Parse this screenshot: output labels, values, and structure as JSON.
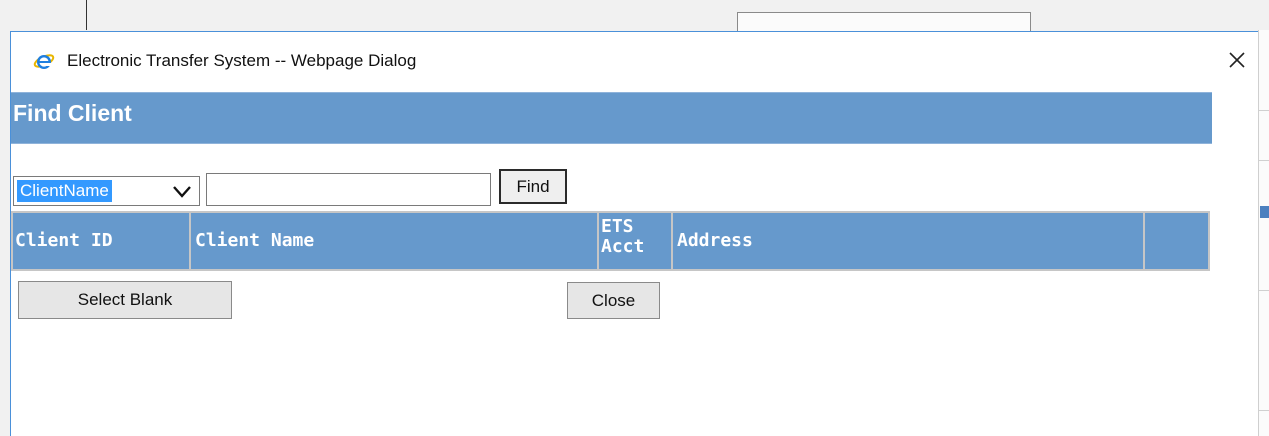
{
  "window": {
    "title": "Electronic Transfer System -- Webpage Dialog",
    "close_icon": "close-icon",
    "app_icon": "internet-explorer-icon"
  },
  "header": {
    "title": "Find Client"
  },
  "search": {
    "field_selected": "ClientName",
    "search_value": "",
    "find_label": "Find"
  },
  "table": {
    "columns": [
      "Client ID",
      "Client Name",
      "ETS Acct",
      "Address",
      ""
    ],
    "column_lines": {
      "ets_acct_line1": "ETS",
      "ets_acct_line2": "Acct"
    },
    "rows": []
  },
  "buttons": {
    "select_blank": "Select Blank",
    "close": "Close"
  },
  "colors": {
    "header_blue": "#6699cc",
    "selection_blue": "#3399ff",
    "window_border": "#4a90d9"
  }
}
